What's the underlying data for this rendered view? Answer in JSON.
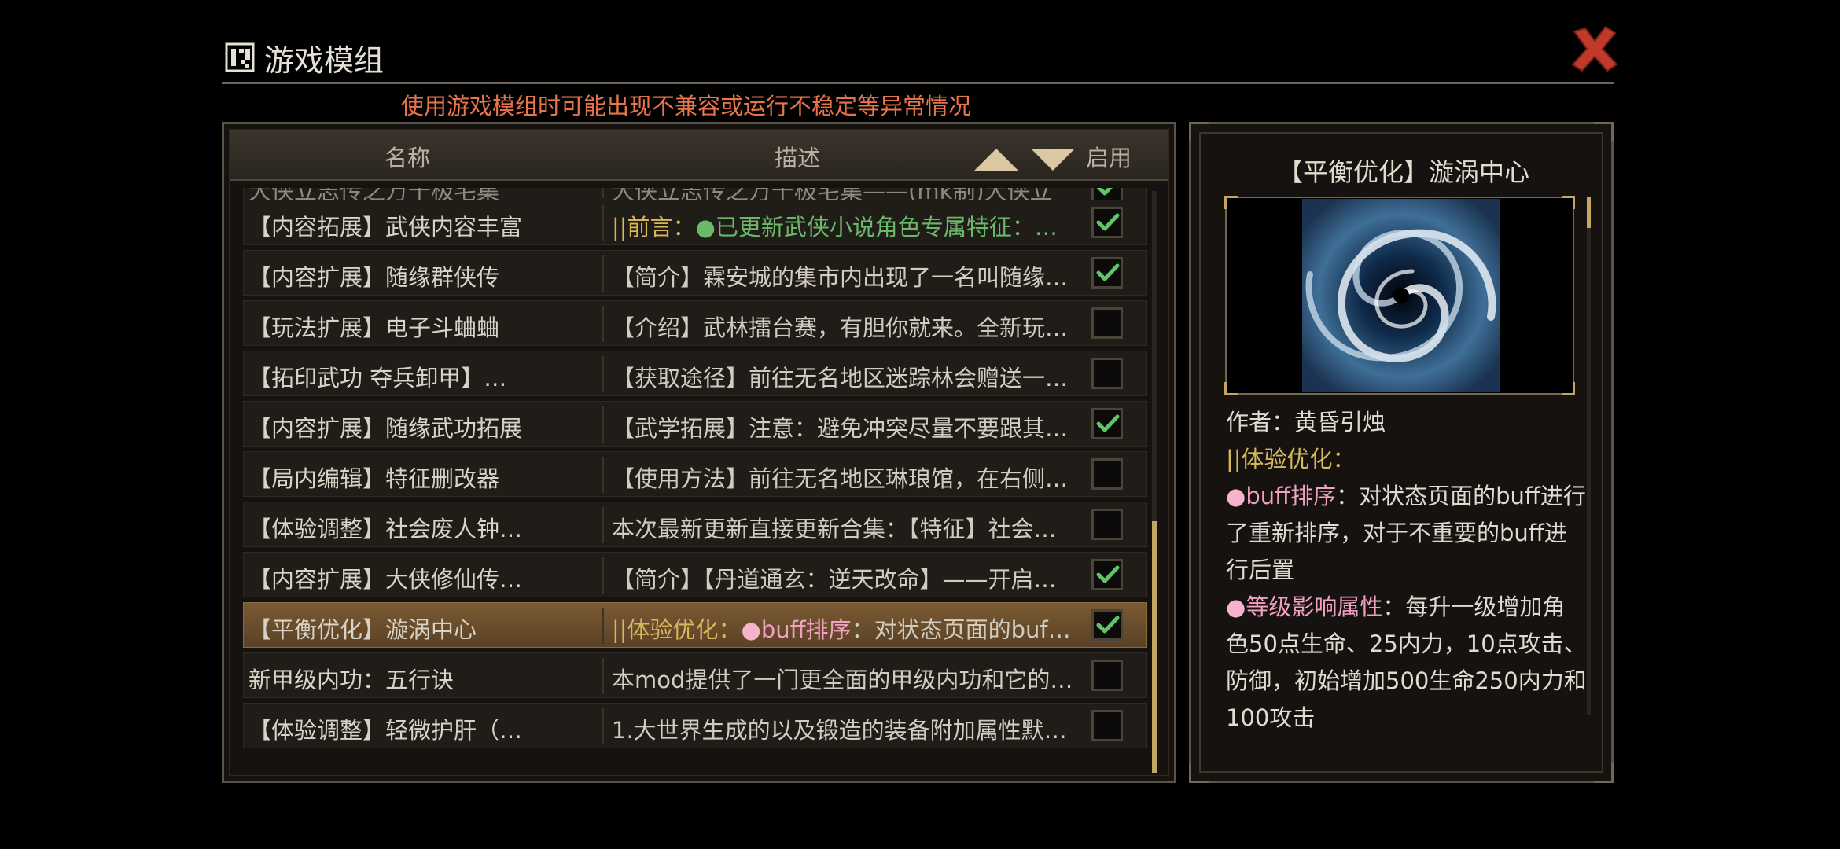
{
  "header": {
    "title": "游戏模组",
    "warning": "使用游戏模组时可能出现不兼容或运行不稳定等异常情况"
  },
  "list": {
    "columns": {
      "name": "名称",
      "desc": "描述",
      "enabled": "启用"
    },
    "partial_row": {
      "name": "大侠立志传之万千极宅集",
      "desc": "大侠立志传之万千极宅集——(mk制)大侠立"
    },
    "rows": [
      {
        "name": "【内容拓展】武侠内容丰富",
        "desc_prefix": "||前言：",
        "desc_dot": "●",
        "desc_rest": "已更新武侠小说角色专属特征：…",
        "enabled": true
      },
      {
        "name": "【内容扩展】随缘群侠传",
        "desc_prefix": "",
        "desc_dot": "",
        "desc_rest": "【简介】霖安城的集市内出现了一名叫随缘…",
        "enabled": true
      },
      {
        "name": "【玩法扩展】电子斗蛐蛐",
        "desc_prefix": "",
        "desc_dot": "",
        "desc_rest": "【介绍】武林擂台赛，有胆你就来。全新玩…",
        "enabled": false
      },
      {
        "name": "【拓印武功 夺兵卸甲】…",
        "desc_prefix": "",
        "desc_dot": "",
        "desc_rest": "【获取途径】前往无名地区迷踪林会赠送一…",
        "enabled": false
      },
      {
        "name": "【内容扩展】随缘武功拓展",
        "desc_prefix": "",
        "desc_dot": "",
        "desc_rest": "【武学拓展】注意：避免冲突尽量不要跟其…",
        "enabled": true
      },
      {
        "name": "【局内编辑】特征删改器",
        "desc_prefix": "",
        "desc_dot": "",
        "desc_rest": "【使用方法】前往无名地区琳琅馆，在右侧…",
        "enabled": false
      },
      {
        "name": "【体验调整】社会废人钟…",
        "desc_prefix": "",
        "desc_dot": "",
        "desc_rest": "本次最新更新直接更新合集：【特征】社会…",
        "enabled": false
      },
      {
        "name": "【内容扩展】大侠修仙传…",
        "desc_prefix": "",
        "desc_dot": "",
        "desc_rest": "【简介】【丹道通玄：逆天改命】——开启…",
        "enabled": true
      },
      {
        "name": "【平衡优化】漩涡中心",
        "desc_prefix": "||体验优化：",
        "desc_dot": "●",
        "desc_keyword": "buff排序",
        "desc_rest": "：对状态页面的buf…",
        "enabled": true,
        "selected": true
      },
      {
        "name": "新甲级内功：五行诀",
        "desc_prefix": "",
        "desc_dot": "",
        "desc_rest": "本mod提供了一门更全面的甲级内功和它的…",
        "enabled": false
      },
      {
        "name": "【体验调整】轻微护肝（…",
        "desc_prefix": "",
        "desc_dot": "",
        "desc_rest": "1.大世界生成的以及锻造的装备附加属性默…",
        "enabled": false
      }
    ]
  },
  "detail": {
    "title": "【平衡优化】漩涡中心",
    "author": "作者：黄昏引烛",
    "section": "||体验优化：",
    "dot": "●",
    "item1_key": "buff排序",
    "item1_text": "：对状态页面的buff进行了重新排序，对于不重要的buff进行后置",
    "item2_key": "等级影响属性",
    "item2_text": "：每升一级增加角色50点生命、25内力，10点攻击、防御，初始增加500生命250内力和100攻击"
  },
  "colors": {
    "accent_gold": "#c4a766",
    "check_green": "#5fc46a",
    "warning": "#e8744a",
    "close_red": "#c0392b"
  }
}
